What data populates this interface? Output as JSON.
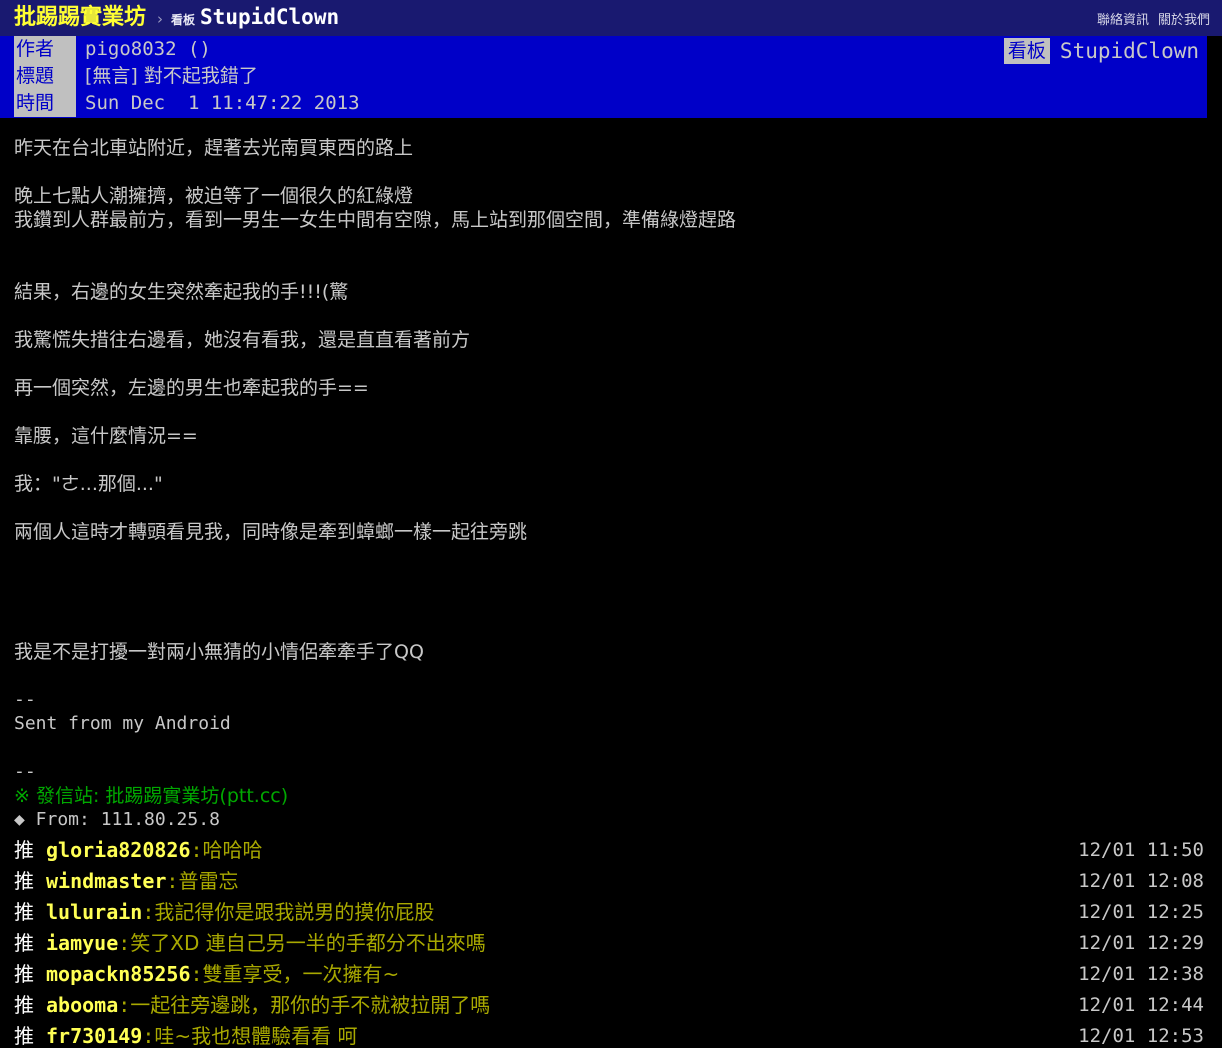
{
  "navbar": {
    "brand": "批踢踢實業坊",
    "separator": "›",
    "crumb_prefix": "看板",
    "board": "StupidClown",
    "links": [
      {
        "label": "聯絡資訊"
      },
      {
        "label": "關於我們"
      }
    ]
  },
  "article_meta": {
    "rows": [
      {
        "label": "作者",
        "value": "pigo8032 ()"
      },
      {
        "label": "標題",
        "value": "[無言] 對不起我錯了"
      },
      {
        "label": "時間",
        "value": "Sun Dec  1 11:47:22 2013"
      }
    ],
    "board_tag_label": "看板",
    "board_tag_name": "StupidClown"
  },
  "body_lines": [
    {
      "text": "昨天在台北車站附近，趕著去光南買東西的路上",
      "style": "cjk",
      "color": "default"
    },
    {
      "text": "",
      "style": "blank",
      "color": "default"
    },
    {
      "text": "晚上七點人潮擁擠，被迫等了一個很久的紅綠燈",
      "style": "cjk",
      "color": "default"
    },
    {
      "text": "我鑽到人群最前方，看到一男生一女生中間有空隙，馬上站到那個空間，準備綠燈趕路",
      "style": "cjk",
      "color": "default"
    },
    {
      "text": "",
      "style": "blank",
      "color": "default"
    },
    {
      "text": "",
      "style": "blank",
      "color": "default"
    },
    {
      "text": "結果，右邊的女生突然牽起我的手!!!(驚",
      "style": "cjk",
      "color": "default"
    },
    {
      "text": "",
      "style": "blank",
      "color": "default"
    },
    {
      "text": "我驚慌失措往右邊看，她沒有看我，還是直直看著前方",
      "style": "cjk",
      "color": "default"
    },
    {
      "text": "",
      "style": "blank",
      "color": "default"
    },
    {
      "text": "再一個突然，左邊的男生也牽起我的手==",
      "style": "cjk",
      "color": "default"
    },
    {
      "text": "",
      "style": "blank",
      "color": "default"
    },
    {
      "text": "靠腰，這什麼情況==",
      "style": "cjk",
      "color": "default"
    },
    {
      "text": "",
      "style": "blank",
      "color": "default"
    },
    {
      "text": "我：\"ㄜ...那個...\"",
      "style": "cjk",
      "color": "default"
    },
    {
      "text": "",
      "style": "blank",
      "color": "default"
    },
    {
      "text": "兩個人這時才轉頭看見我，同時像是牽到蟑螂一樣一起往旁跳",
      "style": "cjk",
      "color": "default"
    },
    {
      "text": "",
      "style": "blank",
      "color": "default"
    },
    {
      "text": "",
      "style": "blank",
      "color": "default"
    },
    {
      "text": "",
      "style": "blank",
      "color": "default"
    },
    {
      "text": "",
      "style": "blank",
      "color": "default"
    },
    {
      "text": "我是不是打擾一對兩小無猜的小情侶牽牽手了QQ",
      "style": "cjk",
      "color": "default"
    },
    {
      "text": "",
      "style": "blank",
      "color": "default"
    },
    {
      "text": "--",
      "style": "mono",
      "color": "default"
    },
    {
      "text": "Sent from my Android",
      "style": "mono",
      "color": "default"
    },
    {
      "text": "",
      "style": "blank",
      "color": "default"
    },
    {
      "text": "--",
      "style": "mono",
      "color": "default"
    },
    {
      "text": "※ 發信站: 批踢踢實業坊(ptt.cc)",
      "style": "cjk",
      "color": "green"
    },
    {
      "text": "◆ From: 111.80.25.8",
      "style": "mono",
      "color": "default"
    }
  ],
  "comments": [
    {
      "tag": "推",
      "user": "gloria820826",
      "colon": ":",
      "text": "哈哈哈",
      "time": "12/01 11:50"
    },
    {
      "tag": "推",
      "user": "windmaster",
      "colon": ":",
      "text": "普雷忘",
      "time": "12/01 12:08"
    },
    {
      "tag": "推",
      "user": "lulurain",
      "colon": ":",
      "text": "我記得你是跟我説男的摸你屁股",
      "time": "12/01 12:25"
    },
    {
      "tag": "推",
      "user": "iamyue",
      "colon": ":",
      "text": "笑了XD 連自己另一半的手都分不出來嗎",
      "time": "12/01 12:29"
    },
    {
      "tag": "推",
      "user": "mopackn85256",
      "colon": ":",
      "text": "雙重享受，一次擁有~",
      "time": "12/01 12:38"
    },
    {
      "tag": "推",
      "user": "abooma",
      "colon": ":",
      "text": "一起往旁邊跳，那你的手不就被拉開了嗎",
      "time": "12/01 12:44"
    },
    {
      "tag": "推",
      "user": "fr730149",
      "colon": ":",
      "text": "哇~我也想體驗看看 呵",
      "time": "12/01 12:53"
    }
  ],
  "colors": {
    "navbar_bg": "#191970",
    "meta_band_bg": "#0000c8",
    "brand": "#ffff33",
    "label_bg": "#c0c0c0",
    "label_fg": "#0000c8",
    "body_text": "#c8c8c8",
    "green": "#00a800",
    "comment_user": "#ffff55",
    "comment_text": "#a8a800",
    "page_bg": "#000000"
  }
}
